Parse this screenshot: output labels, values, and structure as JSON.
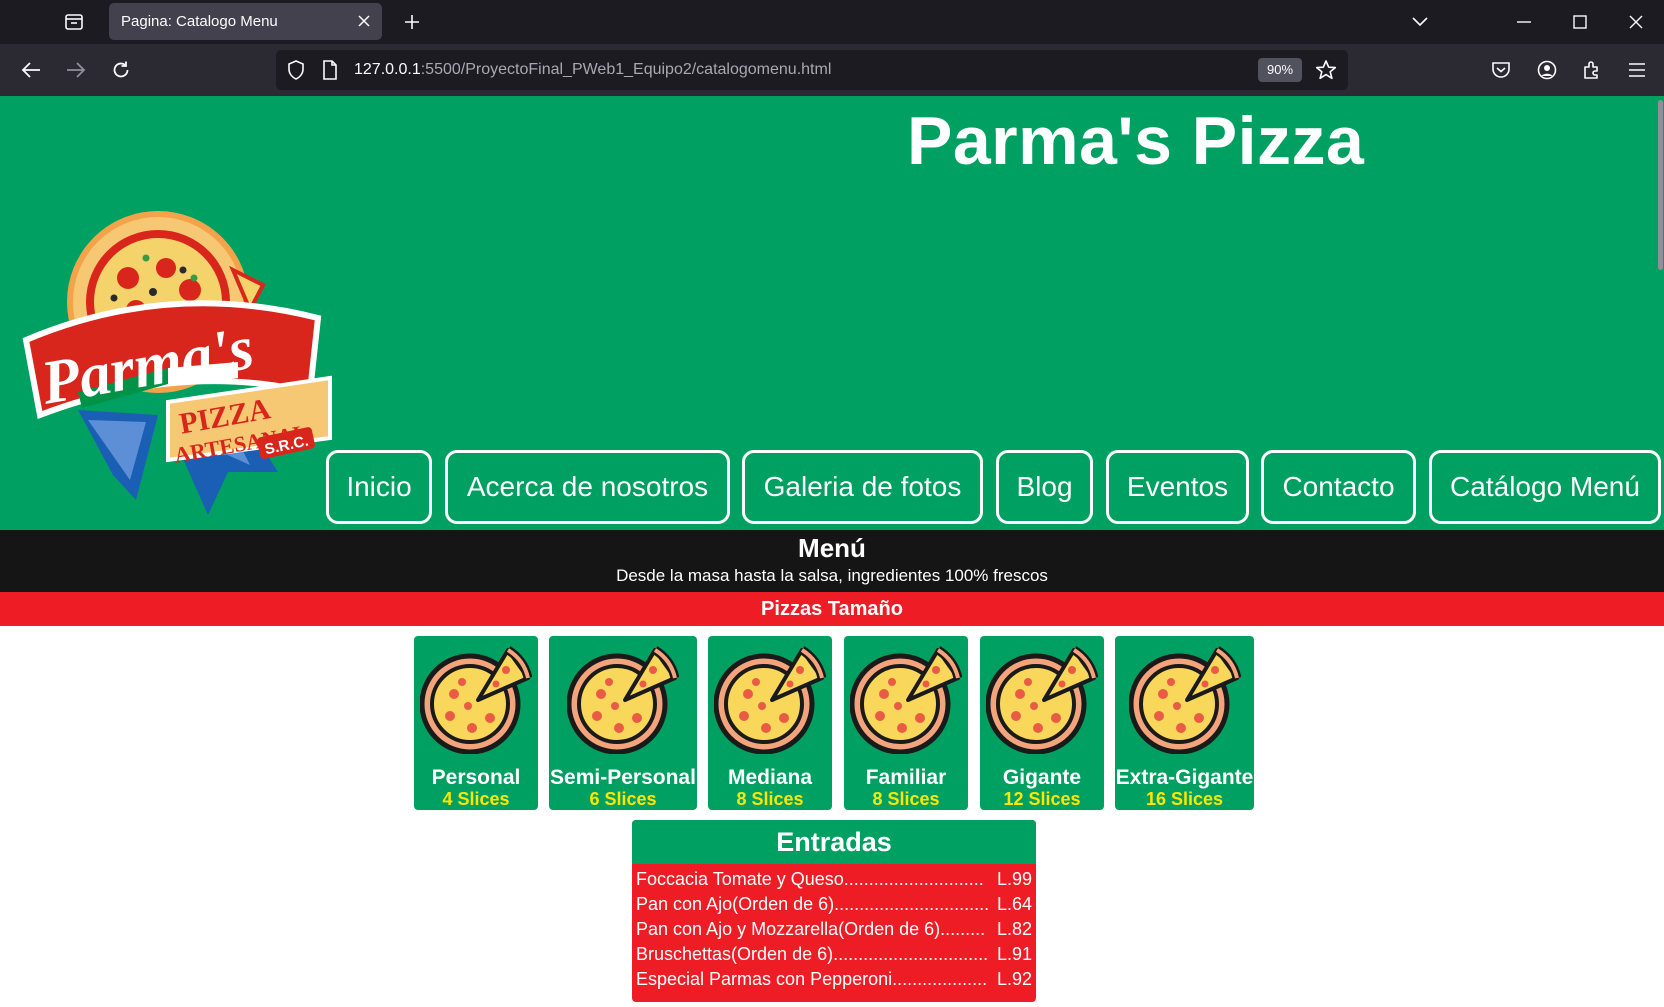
{
  "browser": {
    "tab_title": "Pagina: Catalogo Menu",
    "url_host": "127.0.0.1",
    "url_path": ":5500/ProyectoFinal_PWeb1_Equipo2/catalogomenu.html",
    "zoom": "90%"
  },
  "hero": {
    "title": "Parma's Pizza",
    "logo_text": {
      "brand": "Parma's",
      "line1": "PIZZA",
      "line2": "ARTESANAL",
      "badge": "S.R.C."
    }
  },
  "nav": {
    "items": [
      {
        "label": "Inicio"
      },
      {
        "label": "Acerca de nosotros"
      },
      {
        "label": "Galeria de fotos"
      },
      {
        "label": "Blog"
      },
      {
        "label": "Eventos"
      },
      {
        "label": "Contacto"
      },
      {
        "label": "Catálogo Menú"
      }
    ]
  },
  "menu": {
    "title": "Menú",
    "subtitle": "Desde la masa hasta la salsa, ingredientes 100% frescos"
  },
  "pizzas": {
    "heading": "Pizzas Tamaño",
    "sizes": [
      {
        "name": "Personal",
        "slices": "4 Slices"
      },
      {
        "name": "Semi-Personal",
        "slices": "6 Slices"
      },
      {
        "name": "Mediana",
        "slices": "8 Slices"
      },
      {
        "name": "Familiar",
        "slices": "8 Slices"
      },
      {
        "name": "Gigante",
        "slices": "12 Slices"
      },
      {
        "name": "Extra-Gigante",
        "slices": "16 Slices"
      }
    ]
  },
  "entradas": {
    "heading": "Entradas",
    "items": [
      {
        "name": "Foccacia Tomate y Queso............................",
        "price": "L.99"
      },
      {
        "name": "Pan con Ajo(Orden de 6)...............................",
        "price": "L.64"
      },
      {
        "name": "Pan con Ajo y Mozzarella(Orden de 6).........",
        "price": "L.82"
      },
      {
        "name": "Bruschettas(Orden de 6)...............................",
        "price": "L.91"
      },
      {
        "name": "Especial Parmas con Pepperoni...................",
        "price": "L.92"
      }
    ]
  },
  "colors": {
    "green": "#00a062",
    "red": "#ee1c25",
    "black_band": "#151515",
    "slice_yellow": "#ffe600"
  }
}
